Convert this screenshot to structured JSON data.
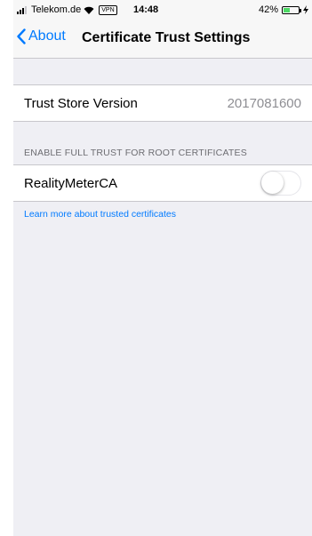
{
  "status_bar": {
    "carrier": "Telekom.de",
    "vpn": "VPN",
    "time": "14:48",
    "battery_percent_label": "42%",
    "battery_level": 0.42,
    "battery_color": "#4cd964",
    "icons": [
      "signal-icon",
      "wifi-icon",
      "battery-icon",
      "charging-icon"
    ]
  },
  "nav": {
    "back_label": "About",
    "title": "Certificate Trust Settings"
  },
  "trust_store": {
    "label": "Trust Store Version",
    "value": "2017081600"
  },
  "root_certificates": {
    "header": "ENABLE FULL TRUST FOR ROOT CERTIFICATES",
    "items": [
      {
        "label": "RealityMeterCA",
        "enabled": false
      }
    ]
  },
  "footer": {
    "link": "Learn more about trusted certificates"
  },
  "colors": {
    "accent": "#007aff",
    "background": "#efeff4",
    "secondary_text": "#8e8e93"
  }
}
